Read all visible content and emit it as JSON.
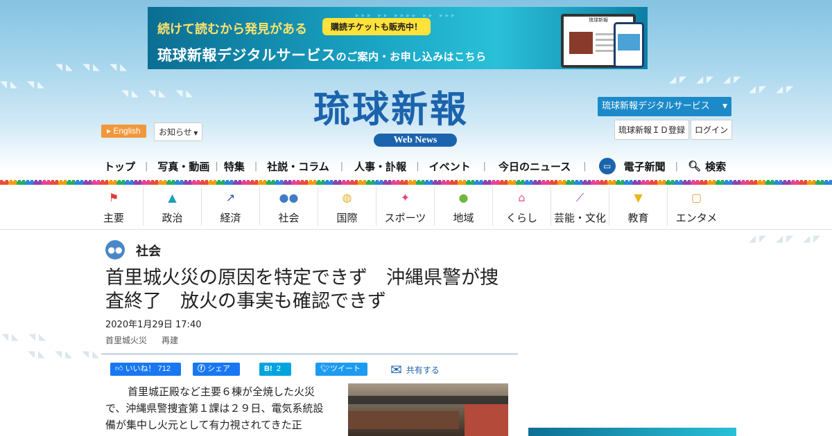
{
  "banner": {
    "line1": "続けて読むから発見がある",
    "pill": "購読チケットも販売中！",
    "line2_main": "琉球新報デジタルサービス",
    "line2_small": "のご案内・お申し込みはこちら",
    "device_title": "琉球新報"
  },
  "header": {
    "english_label": "English",
    "info_label": "お知らせ",
    "logo_text": "琉球新報",
    "logo_sub": "Web News",
    "digital_label": "琉球新報デジタルサービス",
    "id_register_label": "琉球新報ＩＤ登録",
    "login_label": "ログイン"
  },
  "mainnav": {
    "items": [
      "トップ",
      "写真・動画",
      "特集",
      "社説・コラム",
      "人事・訃報",
      "イベント",
      "今日のニュース",
      "電子新聞",
      "検索"
    ]
  },
  "categories": [
    {
      "label": "主要",
      "icon": "flag-icon",
      "color": "#e53935",
      "glyph": "⚑"
    },
    {
      "label": "政治",
      "icon": "parliament-icon",
      "color": "#1ba0b8",
      "glyph": "▲"
    },
    {
      "label": "経済",
      "icon": "chart-icon",
      "color": "#2d4fa1",
      "glyph": "↗"
    },
    {
      "label": "社会",
      "icon": "people-icon",
      "color": "#3f7cc4",
      "glyph": "●●"
    },
    {
      "label": "国際",
      "icon": "globe-icon",
      "color": "#e3b02a",
      "glyph": "◍"
    },
    {
      "label": "スポーツ",
      "icon": "runner-icon",
      "color": "#e8427a",
      "glyph": "✦"
    },
    {
      "label": "地域",
      "icon": "map-pin-icon",
      "color": "#6bb83c",
      "glyph": "●"
    },
    {
      "label": "くらし",
      "icon": "house-icon",
      "color": "#e85b88",
      "glyph": "⌂"
    },
    {
      "label": "芸能・文化",
      "icon": "sanshin-icon",
      "color": "#8e3fa8",
      "glyph": "⟋"
    },
    {
      "label": "教育",
      "icon": "graduation-cap-icon",
      "color": "#e6b81f",
      "glyph": "▼"
    },
    {
      "label": "エンタメ",
      "icon": "tv-icon",
      "color": "#f0983a",
      "glyph": "▢"
    }
  ],
  "article": {
    "section": "社会",
    "headline": "首里城火災の原因を特定できず　沖縄県警が捜査終了　放火の事実も確認できず",
    "date": "2020年1月29日 17:40",
    "tags": [
      "首里城火災",
      "再建"
    ],
    "share": {
      "like_label": "いいね！",
      "like_count": "712",
      "share_label": "シェア",
      "hatena_label": "B!",
      "hatena_count": "2",
      "tweet_label": "ツイート",
      "more_label": "共有する"
    },
    "body": "首里城正殿など主要６棟が全焼した火災で、沖縄県警捜査第１課は２９日、電気系統設備が集中し火元として有力視されてきた正"
  }
}
